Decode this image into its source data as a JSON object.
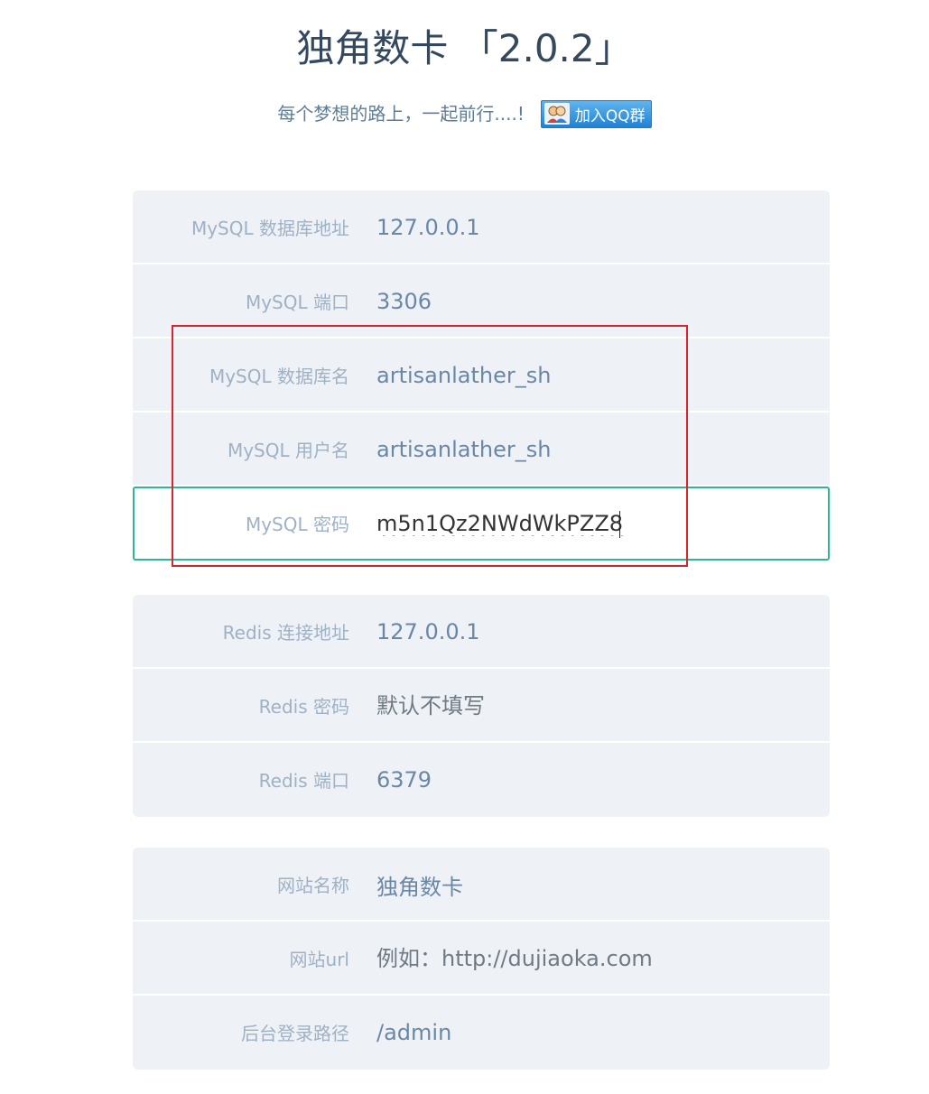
{
  "header": {
    "title": "独角数卡 「2.0.2」",
    "subtitle": "每个梦想的路上，一起前行....!",
    "qq_button_label": "加入QQ群"
  },
  "mysql": {
    "host": {
      "label": "MySQL 数据库地址",
      "value": "127.0.0.1"
    },
    "port": {
      "label": "MySQL 端口",
      "value": "3306"
    },
    "database": {
      "label": "MySQL 数据库名",
      "value": "artisanlather_sh"
    },
    "username": {
      "label": "MySQL 用户名",
      "value": "artisanlather_sh"
    },
    "password": {
      "label": "MySQL 密码",
      "value": "m5n1Qz2NWdWkPZZ8"
    }
  },
  "redis": {
    "host": {
      "label": "Redis 连接地址",
      "value": "127.0.0.1"
    },
    "password": {
      "label": "Redis 密码",
      "placeholder": "默认不填写"
    },
    "port": {
      "label": "Redis 端口",
      "value": "6379"
    }
  },
  "site": {
    "name": {
      "label": "网站名称",
      "value": "独角数卡"
    },
    "url": {
      "label": "网站url",
      "placeholder": "例如：http://dujiaoka.com"
    },
    "admin_path": {
      "label": "后台登录路径",
      "value": "/admin"
    }
  },
  "colors": {
    "focus_border": "#2fb59a",
    "annotation_box": "#d9232d",
    "group_background": "#eef2f6"
  }
}
